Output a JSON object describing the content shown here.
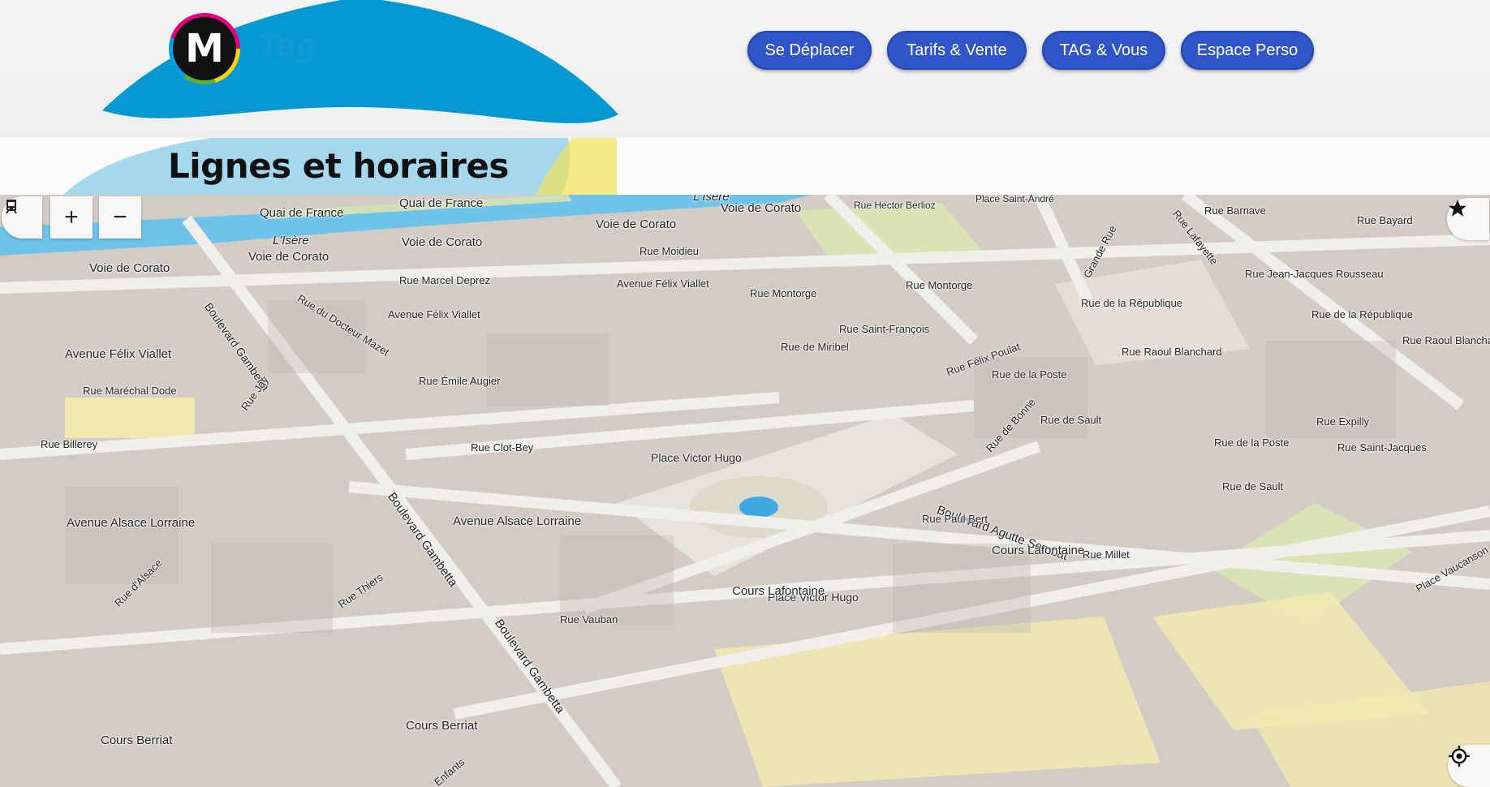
{
  "logo": {
    "letter": "M",
    "brand": "Tag"
  },
  "nav": [
    {
      "label": "Se Déplacer"
    },
    {
      "label": "Tarifs & Vente"
    },
    {
      "label": "TAG & Vous"
    },
    {
      "label": "Espace Perso"
    }
  ],
  "page_title": "Lignes et horaires",
  "map": {
    "controls": {
      "transit_icon": "tram-icon",
      "zoom_in": "+",
      "zoom_out": "−",
      "favorites_icon": "star-icon",
      "locate_icon": "locate-icon"
    },
    "colors": {
      "water": "#6ec3ea",
      "park": "#d9e3b5",
      "building": "#cfc8c0",
      "road": "#f2f0ed",
      "yellow_zone": "#f2e9b0"
    },
    "labels": [
      "Quai de France",
      "Quai de France",
      "L'Isère",
      "L'Isère",
      "Voie de Corato",
      "Voie de Corato",
      "Voie de Corato",
      "Voie de Corato",
      "Voie de Corato",
      "Rue Hector Berlioz",
      "Place Saint-André",
      "Rue Barnave",
      "Rue Bayard",
      "Rue Lafayette",
      "Grande Rue",
      "Rue Jean-Jacques Rousseau",
      "Rue Moidieu",
      "Rue Marcel Deprez",
      "Avenue Félix Viallet",
      "Avenue Félix Viallet",
      "Avenue Félix Viallet",
      "Rue du Docteur Mazet",
      "Rue Montorge",
      "Rue Montorge",
      "Rue de la République",
      "Rue de la République",
      "Rue Raoul Blanchard",
      "Rue Raoul Blanchard",
      "Rue Saint-François",
      "Rue de Miribel",
      "Rue Félix Poulat",
      "Rue de la Poste",
      "Rue de la Poste",
      "Rue de Bonne",
      "Rue de Sault",
      "Rue de Sault",
      "Rue Expilly",
      "Rue Saint-Jacques",
      "Boulevard Gambetta",
      "Boulevard Gambetta",
      "Boulevard Gambetta",
      "Rue Émile Augier",
      "Rue Maréchal Dode",
      "Rue Jay",
      "Rue Billerey",
      "Rue Clot-Bey",
      "Place Victor Hugo",
      "Place Victor Hugo",
      "Avenue Alsace Lorraine",
      "Avenue Alsace Lorraine",
      "Boulevard Agutte Sembat",
      "Rue Millet",
      "Rue d'Alsace",
      "Rue Thiers",
      "Rue Vauban",
      "Rue Paul Bert",
      "Cours Lafontaine",
      "Cours Lafontaine",
      "Cours Berriat",
      "Cours Berriat",
      "Place Vaucanson",
      "Enfants"
    ]
  }
}
